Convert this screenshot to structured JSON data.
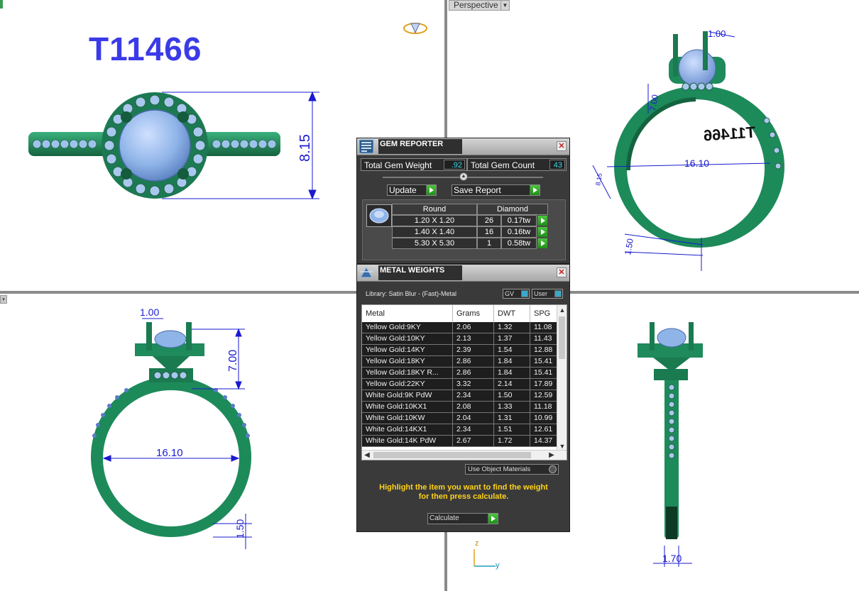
{
  "viewport": {
    "view_label": "Perspective",
    "part_number": "T11466",
    "engraving": "T11466"
  },
  "dimensions": {
    "top_height": "8.15",
    "tr_prong": "1.00",
    "tr_height": "7.00",
    "tr_diameter": "16.10",
    "tr_side": "8.15",
    "tr_band": "1.50",
    "bl_prong": "1.00",
    "bl_height": "7.00",
    "bl_diameter": "16.10",
    "bl_band": "1.50",
    "br_width": "1.70"
  },
  "axes": {
    "z": "z",
    "y": "y"
  },
  "gem_reporter": {
    "title": "GEM REPORTER",
    "total_weight_label": "Total Gem Weight",
    "total_weight_value": ".92",
    "total_count_label": "Total Gem Count",
    "total_count_value": "43",
    "update_label": "Update",
    "save_report_label": "Save Report",
    "shape_header": "Round",
    "material_header": "Diamond",
    "rows": [
      {
        "size": "1.20 X 1.20",
        "count": "26",
        "weight": "0.17tw"
      },
      {
        "size": "1.40 X 1.40",
        "count": "16",
        "weight": "0.16tw"
      },
      {
        "size": "5.30 X 5.30",
        "count": "1",
        "weight": "0.58tw"
      }
    ]
  },
  "metal_weights": {
    "title": "METAL WEIGHTS",
    "library_label": "Library: Satin Blur - (Fast)-Metal",
    "gv_label": "GV",
    "user_label": "User",
    "columns": [
      "Metal",
      "Grams",
      "DWT",
      "SPG"
    ],
    "rows": [
      {
        "metal": "Yellow Gold:9KY",
        "grams": "2.06",
        "dwt": "1.32",
        "spg": "11.08"
      },
      {
        "metal": "Yellow Gold:10KY",
        "grams": "2.13",
        "dwt": "1.37",
        "spg": "11.43"
      },
      {
        "metal": "Yellow Gold:14KY",
        "grams": "2.39",
        "dwt": "1.54",
        "spg": "12.88"
      },
      {
        "metal": "Yellow Gold:18KY",
        "grams": "2.86",
        "dwt": "1.84",
        "spg": "15.41"
      },
      {
        "metal": "Yellow Gold:18KY R...",
        "grams": "2.86",
        "dwt": "1.84",
        "spg": "15.41"
      },
      {
        "metal": "Yellow Gold:22KY",
        "grams": "3.32",
        "dwt": "2.14",
        "spg": "17.89"
      },
      {
        "metal": "White Gold:9K PdW",
        "grams": "2.34",
        "dwt": "1.50",
        "spg": "12.59"
      },
      {
        "metal": "White Gold:10KX1",
        "grams": "2.08",
        "dwt": "1.33",
        "spg": "11.18"
      },
      {
        "metal": "White Gold:10KW",
        "grams": "2.04",
        "dwt": "1.31",
        "spg": "10.99"
      },
      {
        "metal": "White Gold:14KX1",
        "grams": "2.34",
        "dwt": "1.51",
        "spg": "12.61"
      },
      {
        "metal": "White Gold:14K PdW",
        "grams": "2.67",
        "dwt": "1.72",
        "spg": "14.37"
      }
    ],
    "use_object_materials_label": "Use Object Materials",
    "hint_line1": "Highlight the item you want to find the weight",
    "hint_line2": "for then press calculate.",
    "calculate_label": "Calculate"
  },
  "colors": {
    "metal": "#1f8a5c",
    "gem": "#8fb4e8",
    "dimension": "#1a1ad0",
    "part_number": "#3a3ae8",
    "hint": "#ffd21a"
  }
}
